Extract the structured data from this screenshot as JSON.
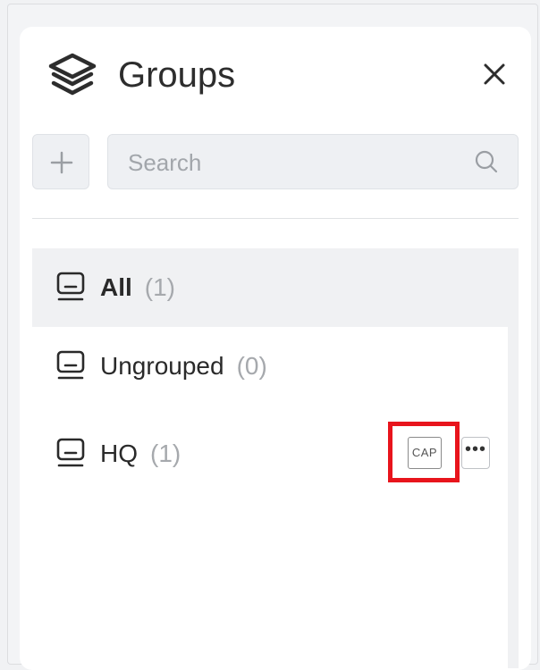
{
  "header": {
    "title": "Groups",
    "icon": "layers-icon",
    "close_icon": "close-icon"
  },
  "toolbar": {
    "add_icon": "plus-icon",
    "search": {
      "placeholder": "Search",
      "value": "",
      "icon": "search-icon"
    }
  },
  "groups": [
    {
      "label": "All",
      "count": "(1)",
      "selected": true,
      "icon": "device-icon"
    },
    {
      "label": "Ungrouped",
      "count": "(0)",
      "selected": false,
      "icon": "device-icon"
    },
    {
      "label": "HQ",
      "count": "(1)",
      "selected": false,
      "icon": "device-icon",
      "badge": "CAP",
      "more_label": "•••"
    }
  ],
  "colors": {
    "highlight": "#e8141c",
    "selected_bg": "#f0f1f3",
    "count_text": "#a6a9ad"
  }
}
